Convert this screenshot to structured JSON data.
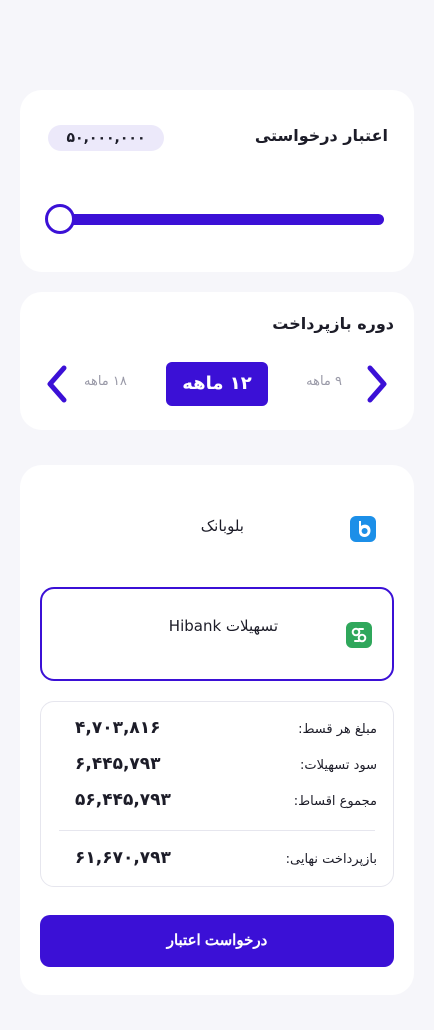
{
  "credit": {
    "title": "اعتبار درخواستی",
    "amount": "۵۰,۰۰۰,۰۰۰",
    "slider_value_fraction": 0.0
  },
  "period": {
    "title": "دوره بازپرداخت",
    "prev_option": "۱۸ ماهه",
    "selected": "۱۲ ماهه",
    "next_option": "۹ ماهه"
  },
  "providers": [
    {
      "name": "بلوبانک",
      "icon": "blubank-logo-icon",
      "selected": false,
      "color": "#1c8fe8"
    },
    {
      "name": "تسهیلات Hibank",
      "icon": "hibank-logo-icon",
      "selected": true,
      "color": "#2fa75b"
    }
  ],
  "summary": {
    "installment_label": "مبلغ هر قسط:",
    "installment_value": "۴,۷۰۳,۸۱۶",
    "interest_label": "سود تسهیلات:",
    "interest_value": "۶,۴۴۵,۷۹۳",
    "total_installments_label": "مجموع اقساط:",
    "total_installments_value": "۵۶,۴۴۵,۷۹۳",
    "final_label": "بازپرداخت نهایی:",
    "final_value": "۶۱,۶۷۰,۷۹۳"
  },
  "submit_label": "درخواست اعتبار",
  "colors": {
    "accent": "#3b10d6",
    "background": "#f6f6fa",
    "pill": "#ece9fa"
  }
}
